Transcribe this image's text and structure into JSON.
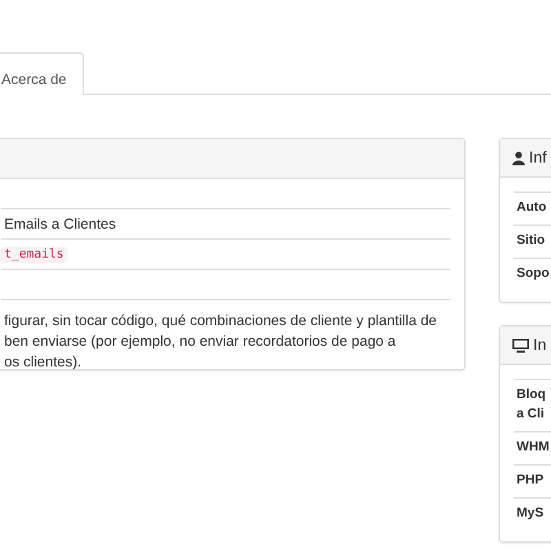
{
  "tabs": [
    {
      "label": "Acerca de",
      "selected": true
    }
  ],
  "main_panel": {
    "rows": [
      {
        "kind": "blank"
      },
      {
        "kind": "text",
        "text": "Emails a Clientes"
      },
      {
        "kind": "code",
        "text": "t_emails"
      },
      {
        "kind": "blank"
      }
    ],
    "description": [
      "figurar, sin tocar código, qué combinaciones de cliente y plantilla de",
      "ben enviarse (por ejemplo, no enviar recordatorios de pago a",
      "os clientes)."
    ]
  },
  "side_panels": [
    {
      "title": "Inf",
      "rows": [
        [
          "Auto"
        ],
        [
          "Sitio"
        ],
        [
          "Sopo"
        ]
      ]
    },
    {
      "title": "In",
      "rows": [
        [
          "Bloq",
          "a Cli"
        ],
        [
          "WHM"
        ],
        [
          "PHP"
        ],
        [
          "MyS"
        ]
      ]
    }
  ]
}
